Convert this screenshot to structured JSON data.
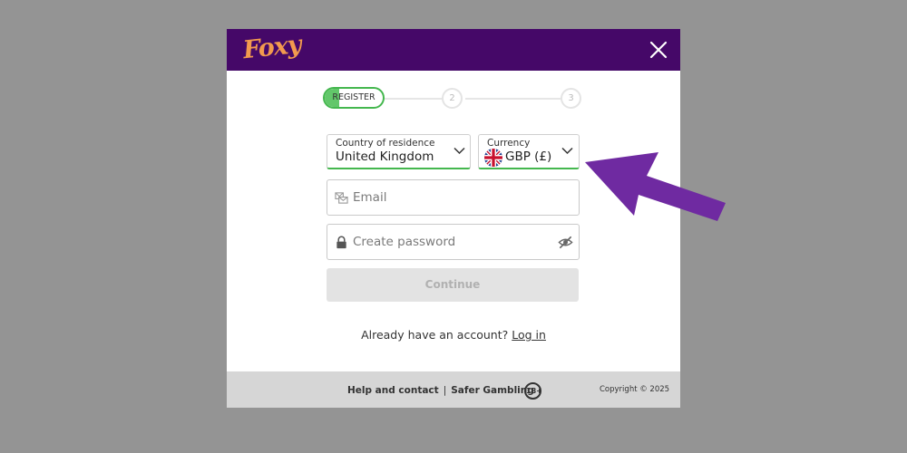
{
  "header": {
    "logo_text": "Foxy",
    "brand_color": "#450868",
    "logo_color": "#f29a4e"
  },
  "stepper": {
    "active_label": "REGISTER",
    "steps": [
      "2",
      "3"
    ],
    "accent_color": "#44b74e"
  },
  "form": {
    "country": {
      "label": "Country of residence",
      "value": "United Kingdom"
    },
    "currency": {
      "label": "Currency",
      "value": "GBP (£)",
      "flag_icon": "uk-flag-icon"
    },
    "email": {
      "placeholder": "Email",
      "icon": "email-icon"
    },
    "password": {
      "placeholder": "Create password",
      "icon": "lock-icon",
      "toggle_icon": "eye-off-icon"
    },
    "continue_label": "Continue"
  },
  "login": {
    "prompt": "Already have an account?",
    "link": "Log in"
  },
  "footer": {
    "help_link": "Help and contact",
    "separator": "|",
    "safer_link": "Safer Gambling",
    "age_badge": "18+",
    "copyright": "Copyright © 2025"
  },
  "annotation": {
    "arrow_color": "#6f2aa1"
  }
}
